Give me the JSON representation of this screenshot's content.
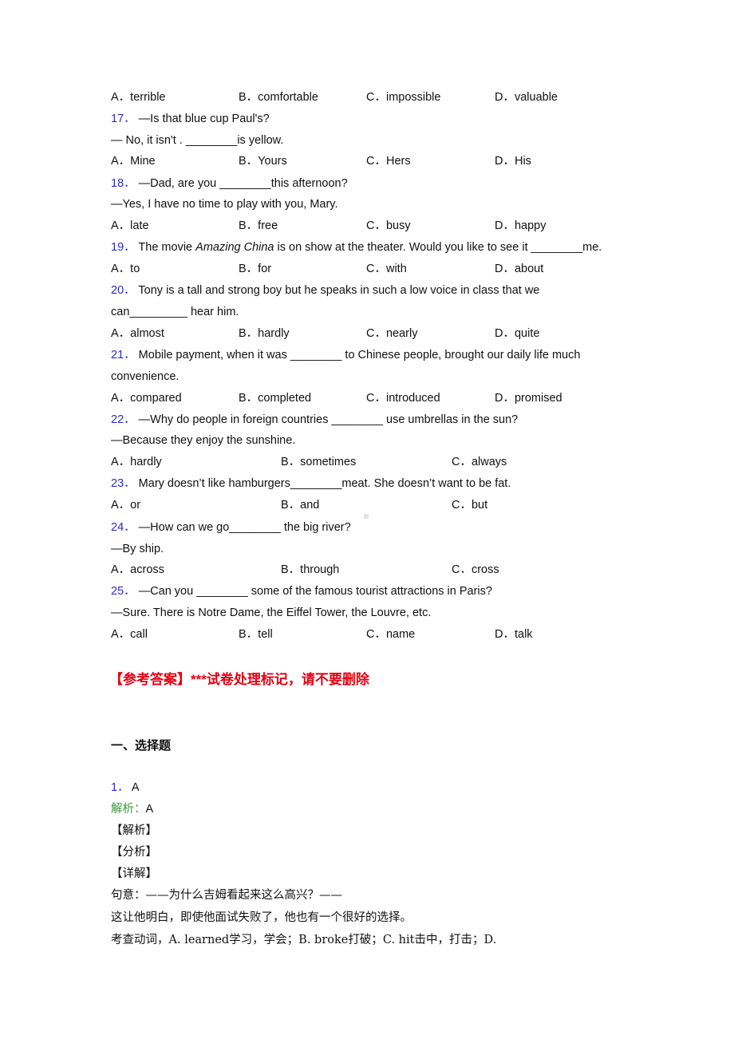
{
  "questions": [
    {
      "num": "",
      "lines": [],
      "options": [
        "A．terrible",
        "B．comfortable",
        "C．impossible",
        "D．valuable"
      ]
    },
    {
      "num": "17．",
      "lines": [
        "—Is that blue cup Paul's?",
        "— No, it isn't . ________is yellow."
      ],
      "options": [
        "A．Mine",
        "B．Yours",
        "C．Hers",
        "D．His"
      ]
    },
    {
      "num": "18．",
      "lines": [
        "—Dad, are you ________this afternoon?",
        "—Yes, I have no time to play with you, Mary."
      ],
      "options": [
        "A．late",
        "B．free",
        "C．busy",
        "D．happy"
      ]
    },
    {
      "num": "19．",
      "lines": [
        "The movie ",
        "Amazing China",
        " is on show at the theater. Would you like to see it ________me."
      ],
      "options": [
        "A．to",
        "B．for",
        "C．with",
        "D．about"
      ]
    },
    {
      "num": "20．",
      "lines": [
        "Tony is a tall and strong boy but he speaks in such a low voice in class that we",
        "can_________ hear him."
      ],
      "options": [
        "A．almost",
        "B．hardly",
        "C．nearly",
        "D．quite"
      ]
    },
    {
      "num": "21．",
      "lines": [
        "Mobile payment, when it was ________ to Chinese people, brought our daily life much",
        "convenience."
      ],
      "options": [
        "A．compared",
        "B．completed",
        "C．introduced",
        "D．promised"
      ]
    },
    {
      "num": "22．",
      "lines": [
        "—Why do people in foreign countries ________ use umbrellas in the sun?",
        "—Because they enjoy the sunshine."
      ],
      "options": [
        "A．hardly",
        "B．sometimes",
        "C．always"
      ]
    },
    {
      "num": "23．",
      "lines": [
        "Mary doesn’t like hamburgers________meat. She doesn’t want to be fat."
      ],
      "options": [
        "A．or",
        "B．and",
        "C．but"
      ]
    },
    {
      "num": "24．",
      "lines": [
        "—How can we go________ the big river?",
        "—By ship."
      ],
      "options": [
        "A．across",
        "B．through",
        "C．cross"
      ]
    },
    {
      "num": "25．",
      "lines": [
        "—Can you ________ some of the famous tourist attractions in Paris?",
        "—Sure. There is Notre Dame, the Eiffel Tower, the Louvre, etc."
      ],
      "options": [
        "A．call",
        "B．tell",
        "C．name",
        "D．talk"
      ]
    }
  ],
  "answer_header": "【参考答案】***试卷处理标记，请不要删除",
  "section_title": "一、选择题",
  "answer1": {
    "num": "1．",
    "answer": "A",
    "analysis_label": "解析：",
    "analysis_value": "A",
    "tag_jiexi": "【解析】",
    "tag_fenxi": "【分析】",
    "tag_xiangjie": "【详解】",
    "meaning1": "句意：——为什么吉姆看起来这么高兴？——",
    "meaning2": "这让他明白，即使他面试失败了，他也有一个很好的选择。",
    "explain": "考查动词，A. learned学习，学会；B. broke打破；C. hit击中，打击；D."
  }
}
